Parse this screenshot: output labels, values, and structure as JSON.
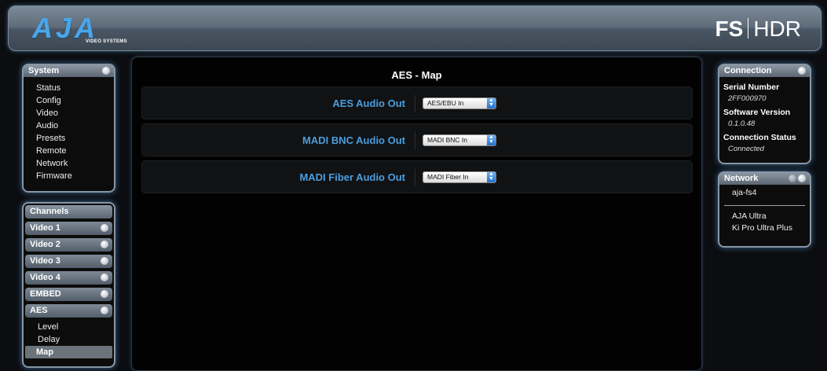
{
  "header": {
    "logo_text": "AJA",
    "logo_subtext": "VIDEO SYSTEMS",
    "product_fs": "FS",
    "product_hdr": "HDR"
  },
  "system": {
    "title": "System",
    "items": [
      "Status",
      "Config",
      "Video",
      "Audio",
      "Presets",
      "Remote",
      "Network",
      "Firmware"
    ]
  },
  "channels": {
    "title": "Channels",
    "items": [
      "Video 1",
      "Video 2",
      "Video 3",
      "Video 4",
      "EMBED",
      "AES"
    ],
    "aes_sub": [
      "Level",
      "Delay",
      "Map"
    ],
    "active_sub": "Map"
  },
  "main": {
    "title": "AES - Map",
    "rows": [
      {
        "label": "AES Audio Out",
        "value": "AES/EBU In"
      },
      {
        "label": "MADI BNC Audio Out",
        "value": "MADI BNC In"
      },
      {
        "label": "MADI Fiber Audio Out",
        "value": "MADI Fiber In"
      }
    ]
  },
  "connection": {
    "title": "Connection",
    "serial_label": "Serial Number",
    "serial_value": "2FF000970",
    "software_label": "Software Version",
    "software_value": "0.1.0.48",
    "status_label": "Connection Status",
    "status_value": "Connected"
  },
  "network": {
    "title": "Network",
    "current": "aja-fs4",
    "devices": [
      "AJA Ultra",
      "Ki Pro Ultra Plus"
    ]
  },
  "icons": {
    "panel_toggle": "circle-toggle-icon",
    "select_arrow": "updown-arrow-icon"
  },
  "colors": {
    "accent_blue": "#4a9edf",
    "panel_glow": "#64b4ff"
  }
}
